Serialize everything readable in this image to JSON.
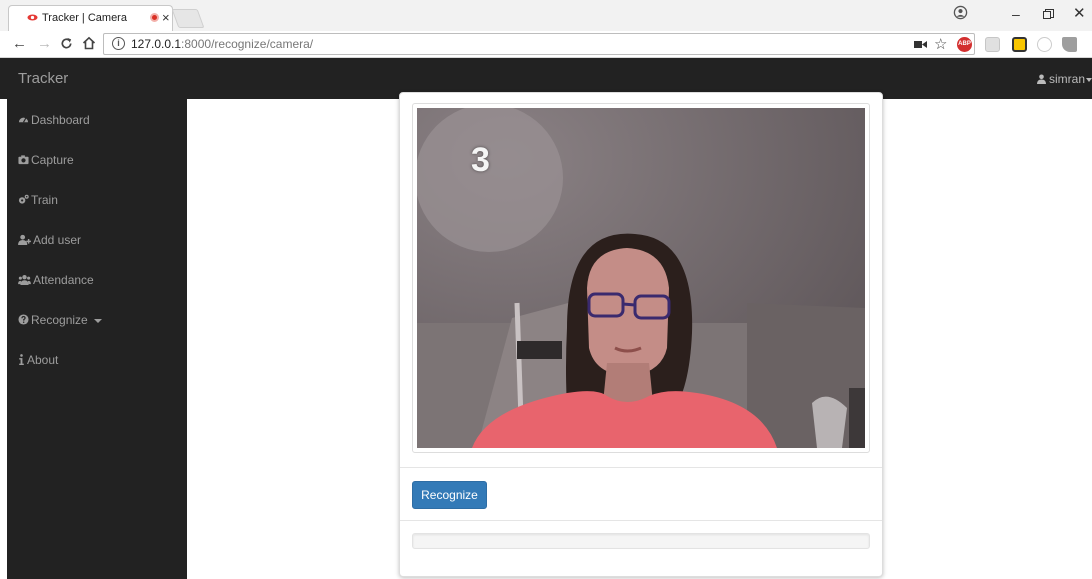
{
  "browser": {
    "tab_title": "Tracker | Camera",
    "tab_close": "×",
    "url_host": "127.0.0.1",
    "url_path": ":8000/recognize/camera/",
    "info_glyph": "i"
  },
  "navbar": {
    "brand": "Tracker",
    "user": "simran"
  },
  "sidebar": {
    "items": [
      {
        "label": "Dashboard",
        "icon": "dashboard-icon"
      },
      {
        "label": "Capture",
        "icon": "camera-icon"
      },
      {
        "label": "Train",
        "icon": "gears-icon"
      },
      {
        "label": "Add user",
        "icon": "user-plus-icon"
      },
      {
        "label": "Attendance",
        "icon": "users-icon"
      },
      {
        "label": "Recognize",
        "icon": "question-circle-icon"
      },
      {
        "label": "About",
        "icon": "info-icon"
      }
    ]
  },
  "camera": {
    "countdown": "3"
  },
  "panel": {
    "recognize_button": "Recognize",
    "progress": 0
  },
  "colors": {
    "navbar_bg": "#222222",
    "primary": "#337ab7"
  }
}
